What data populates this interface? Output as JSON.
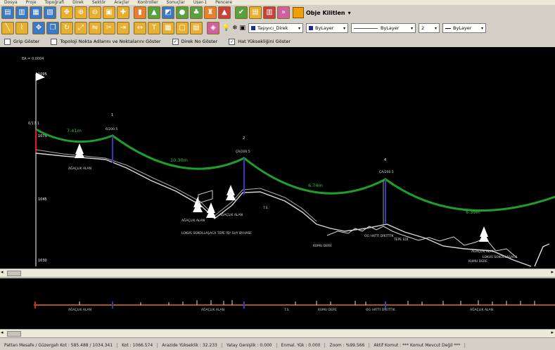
{
  "menu": [
    "Dosya",
    "Proje",
    "Topoğrafi",
    "Direk",
    "Sektör",
    "Araçlar",
    "Kontroller",
    "Sonuçlar",
    "User-1",
    "Pencere"
  ],
  "toolbar": {
    "obje_kilitlen": "Obje Kilitlen",
    "layer_dropdown": "Taşıyıcı_Direk",
    "color_dropdown": "ByLayer",
    "linetype_dropdown": "ByLayer",
    "weight_dropdown": "2",
    "lineweight_dropdown": "ByLayer"
  },
  "options": {
    "grip": "Grip Göster",
    "topoloji": "Topoloji Nokta Adlarını ve Noktalarını Göster",
    "direk_no": "Direk No Göster",
    "hat_yuksekligi": "Hat Yüksekliğini Göster"
  },
  "profile": {
    "scale_label": "EA = 0.0004",
    "elev_top": "1095",
    "elev_1": "1075",
    "elev_2": "1045",
    "elev_3": "1030",
    "left_tag": "6/17.1",
    "tower_1_num": "1",
    "tower_1_label": "6/200.5",
    "tower_2_num": "2",
    "tower_2_label": "ÇA/200.5",
    "tower_4_num": "4",
    "tower_4_label": "ÇA/200.5",
    "span_1": "7.41m",
    "span_2": "10.30m",
    "span_3": "6.74m",
    "span_4": "6.39m",
    "note_1": "AĞAÇLIK ALAN",
    "note_2": "AĞAÇLIK ALAN",
    "note_3": "AĞAÇLIK ALAN",
    "note_4": "LOKUS SOKOLLAŞACA TEPE İŞY SHY BYHASE",
    "note_5": "T.S.",
    "note_6": "KUMU DERE",
    "note_7": "OG HATTI DİKİTTİK",
    "note_8": "TEPE EDİ",
    "note_9": "AĞAÇLIK ALAN",
    "note_10": "LOKUS SOKOLLAŞACA",
    "note_11": "KUMU DERE"
  },
  "overview_labels": {
    "o1": "AĞAÇLIK ALAN",
    "o2": "AĞAÇLIK ALAN",
    "o3": "T.S.",
    "o4": "KUMU DERE",
    "o5": "OG HATTI DİKİTTİK",
    "o6": "AĞAÇLIK ALAN"
  },
  "status": {
    "s1": "Pattan Mesafe / Güzergah Kot : 585.488 / 1034.341",
    "s2": "Kot : 1066.574",
    "s3": "Arazide Yükseklik : 32.233",
    "s4": "Yatay Genişlik : 0.000",
    "s5": "Enmal. Yük : 0.000",
    "s6": "Zoom : %99.566",
    "s7": "Aktif Komut : *** Komut Mevcut Değil ***"
  },
  "colors": {
    "conductor": "#1f9e2a",
    "ground": "#d8d8d8",
    "tower": "#3a3ab8",
    "accent": "#f0a000"
  }
}
